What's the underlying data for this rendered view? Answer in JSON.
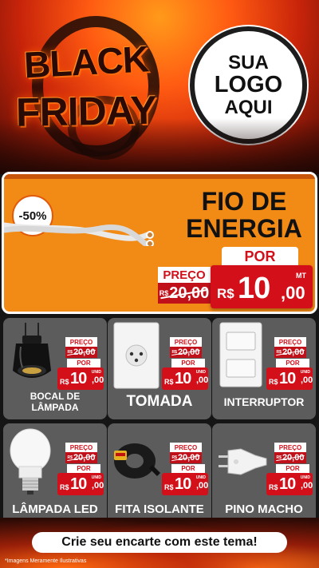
{
  "header": {
    "black": "BLACK",
    "friday": "FRIDAY",
    "logo_line1": "SUA",
    "logo_line2": "LOGO",
    "logo_line3": "AQUI"
  },
  "hero": {
    "discount": "-50%",
    "title_line1": "FIO DE",
    "title_line2": "ENERGIA",
    "por_label": "POR",
    "preco_label": "PREÇO",
    "old_currency": "R$",
    "old_price": "20,00",
    "currency": "R$",
    "price_int": "10",
    "price_cents": ",00",
    "unit": "MT"
  },
  "products": [
    {
      "name_line1": "BOCAL DE",
      "name_line2": "LÂMPADA",
      "preco_label": "PREÇO",
      "old_currency": "R$",
      "old_price": "20,00",
      "por_label": "POR",
      "currency": "R$",
      "price_int": "10",
      "price_cents": ",00",
      "unit": "UNID"
    },
    {
      "name_line1": "TOMADA",
      "name_line2": "",
      "preco_label": "PREÇO",
      "old_currency": "R$",
      "old_price": "20,00",
      "por_label": "POR",
      "currency": "R$",
      "price_int": "10",
      "price_cents": ",00",
      "unit": "UNID"
    },
    {
      "name_line1": "INTERRUPTOR",
      "name_line2": "",
      "preco_label": "PREÇO",
      "old_currency": "R$",
      "old_price": "20,00",
      "por_label": "POR",
      "currency": "R$",
      "price_int": "10",
      "price_cents": ",00",
      "unit": "UNID"
    },
    {
      "name_line1": "LÂMPADA LED",
      "name_line2": "",
      "preco_label": "PREÇO",
      "old_currency": "R$",
      "old_price": "20,00",
      "por_label": "POR",
      "currency": "R$",
      "price_int": "10",
      "price_cents": ",00",
      "unit": "UNID"
    },
    {
      "name_line1": "FITA ISOLANTE",
      "name_line2": "",
      "preco_label": "PREÇO",
      "old_currency": "R$",
      "old_price": "20,00",
      "por_label": "POR",
      "currency": "R$",
      "price_int": "10",
      "price_cents": ",00",
      "unit": "UNID"
    },
    {
      "name_line1": "PINO MACHO",
      "name_line2": "",
      "preco_label": "PREÇO",
      "old_currency": "R$",
      "old_price": "20,00",
      "por_label": "POR",
      "currency": "R$",
      "price_int": "10",
      "price_cents": ",00",
      "unit": "UNID"
    }
  ],
  "footer": {
    "cta": "Crie seu encarte com este tema!",
    "disclaimer": "*Imagens Meramente Ilustrativas"
  },
  "colors": {
    "orange": "#f28a16",
    "red": "#d3101a",
    "card_gray": "#5c5c5c",
    "dark": "#151515"
  },
  "icons": [
    "bulb-socket-icon",
    "power-outlet-icon",
    "light-switch-icon",
    "led-bulb-icon",
    "insulating-tape-icon",
    "plug-icon",
    "electric-cable-icon"
  ]
}
